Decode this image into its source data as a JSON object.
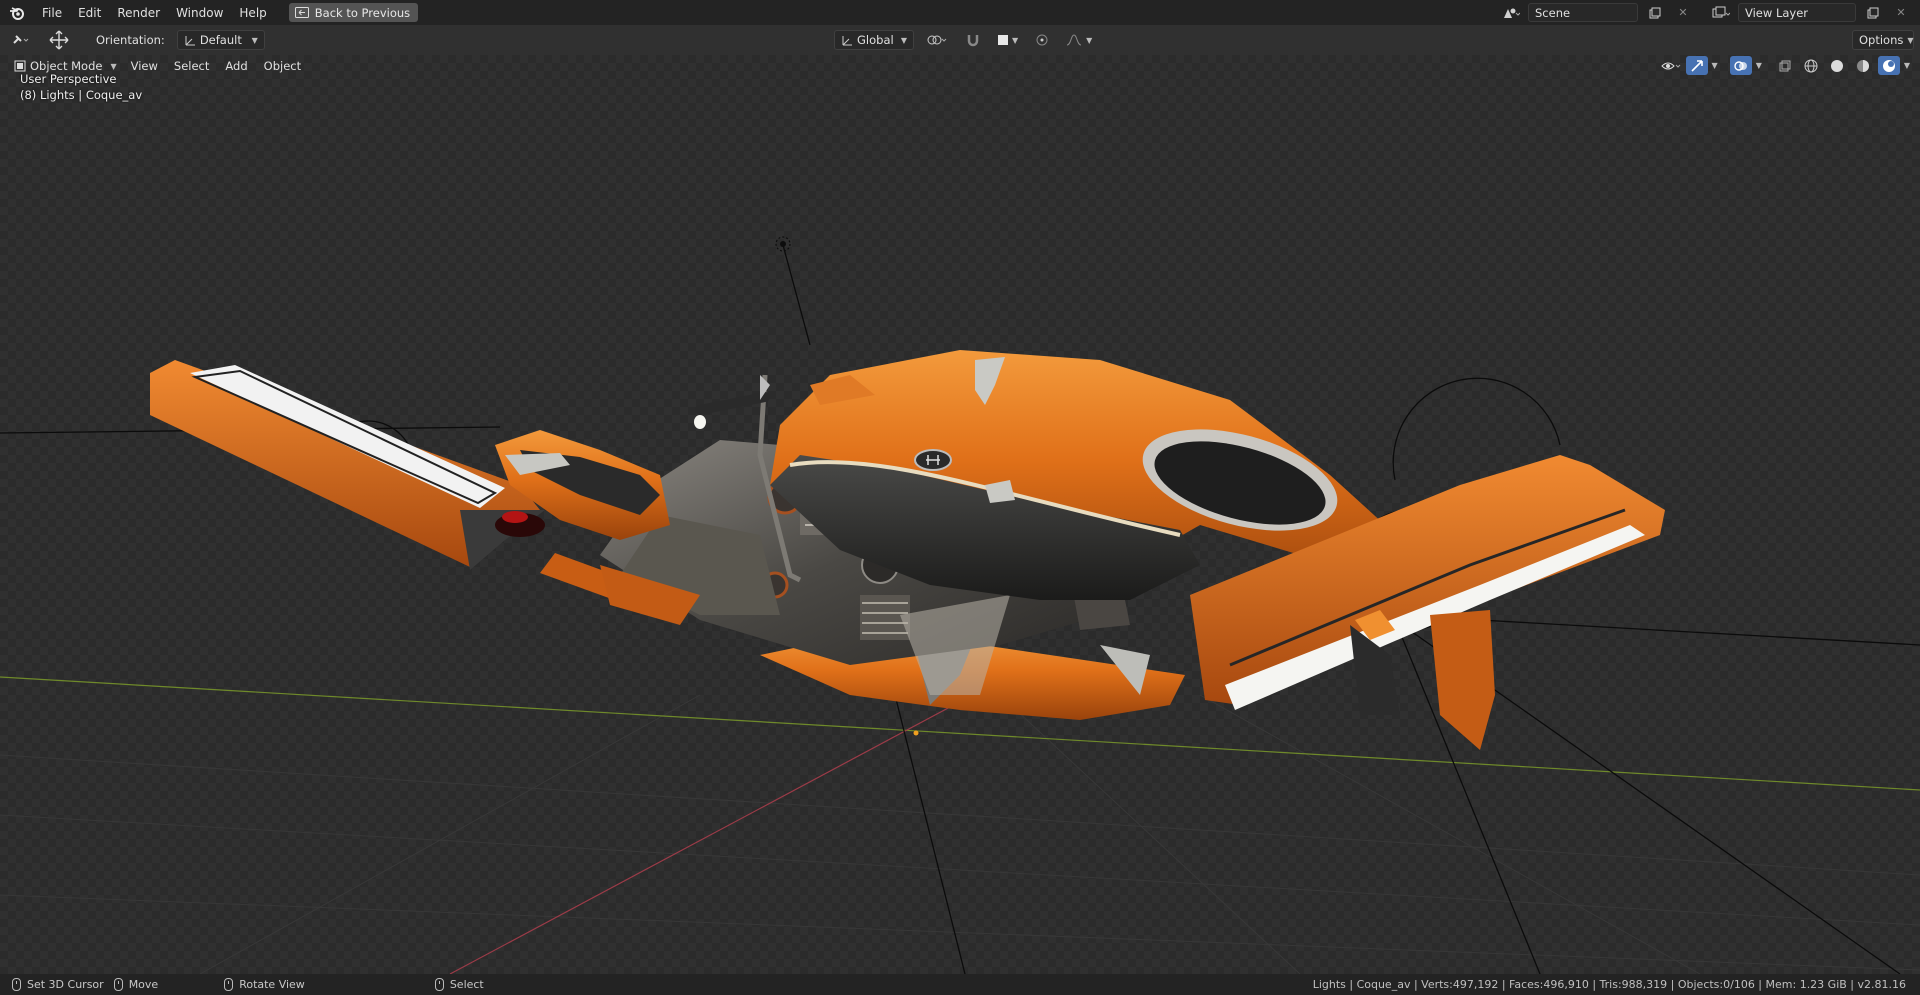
{
  "topbar": {
    "menu": [
      "File",
      "Edit",
      "Render",
      "Window",
      "Help"
    ],
    "back_button": "Back to Previous",
    "scene": "Scene",
    "view_layer": "View Layer"
  },
  "tool_header": {
    "orientation_label": "Orientation:",
    "orientation_value": "Default",
    "transform_space": "Global",
    "options": "Options"
  },
  "viewport_header": {
    "mode": "Object Mode",
    "menu": [
      "View",
      "Select",
      "Add",
      "Object"
    ]
  },
  "viewport": {
    "view_name": "User Perspective",
    "context": "(8) Lights | Coque_av"
  },
  "statusbar": {
    "set_cursor": "Set 3D Cursor",
    "move": "Move",
    "rotate": "Rotate View",
    "select": "Select",
    "stats": "Lights | Coque_av | Verts:497,192 | Faces:496,910 | Tris:988,319 | Objects:0/106 | Mem: 1.23 GiB | v2.81.16"
  },
  "icons": [
    "blender-logo-icon",
    "editor-type-icon",
    "transform-gizmo-icon",
    "scene-icon",
    "view-layer-icon",
    "new-icon",
    "close-icon",
    "snap-icon",
    "proportional-icon",
    "visibility-icon",
    "gizmo-icon",
    "overlay-icon",
    "xray-icon",
    "wireframe-shading-icon",
    "solid-shading-icon",
    "material-shading-icon",
    "rendered-shading-icon",
    "mouse-left-icon",
    "mouse-middle-icon"
  ],
  "colors": {
    "accent": "#4772b3",
    "bike_orange": "#e0701e",
    "x_axis": "#9c3b48",
    "y_axis": "#6f8a2a"
  }
}
